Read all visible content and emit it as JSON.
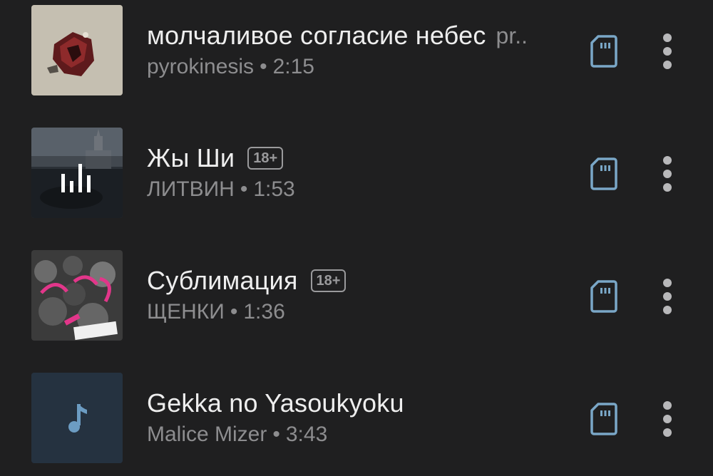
{
  "tracks": [
    {
      "title": "молчаливое согласие небес",
      "title_extra": "pr..",
      "artist": "pyrokinesis",
      "duration": "2:15",
      "badge": "",
      "cover_icon": "album-art"
    },
    {
      "title": "Жы Ши",
      "title_extra": "",
      "artist": "ЛИТВИН",
      "duration": "1:53",
      "badge": "18+",
      "cover_icon": "now-playing-equalizer-icon"
    },
    {
      "title": "Сублимация",
      "title_extra": "",
      "artist": "ЩЕНКИ",
      "duration": "1:36",
      "badge": "18+",
      "cover_icon": "album-art"
    },
    {
      "title": "Gekka no Yasoukyoku",
      "title_extra": "",
      "artist": "Malice Mizer",
      "duration": "3:43",
      "badge": "",
      "cover_icon": "music-note-icon"
    }
  ],
  "separator": "•",
  "colors": {
    "background": "#1f1f20",
    "accent": "#7aa7c7"
  }
}
